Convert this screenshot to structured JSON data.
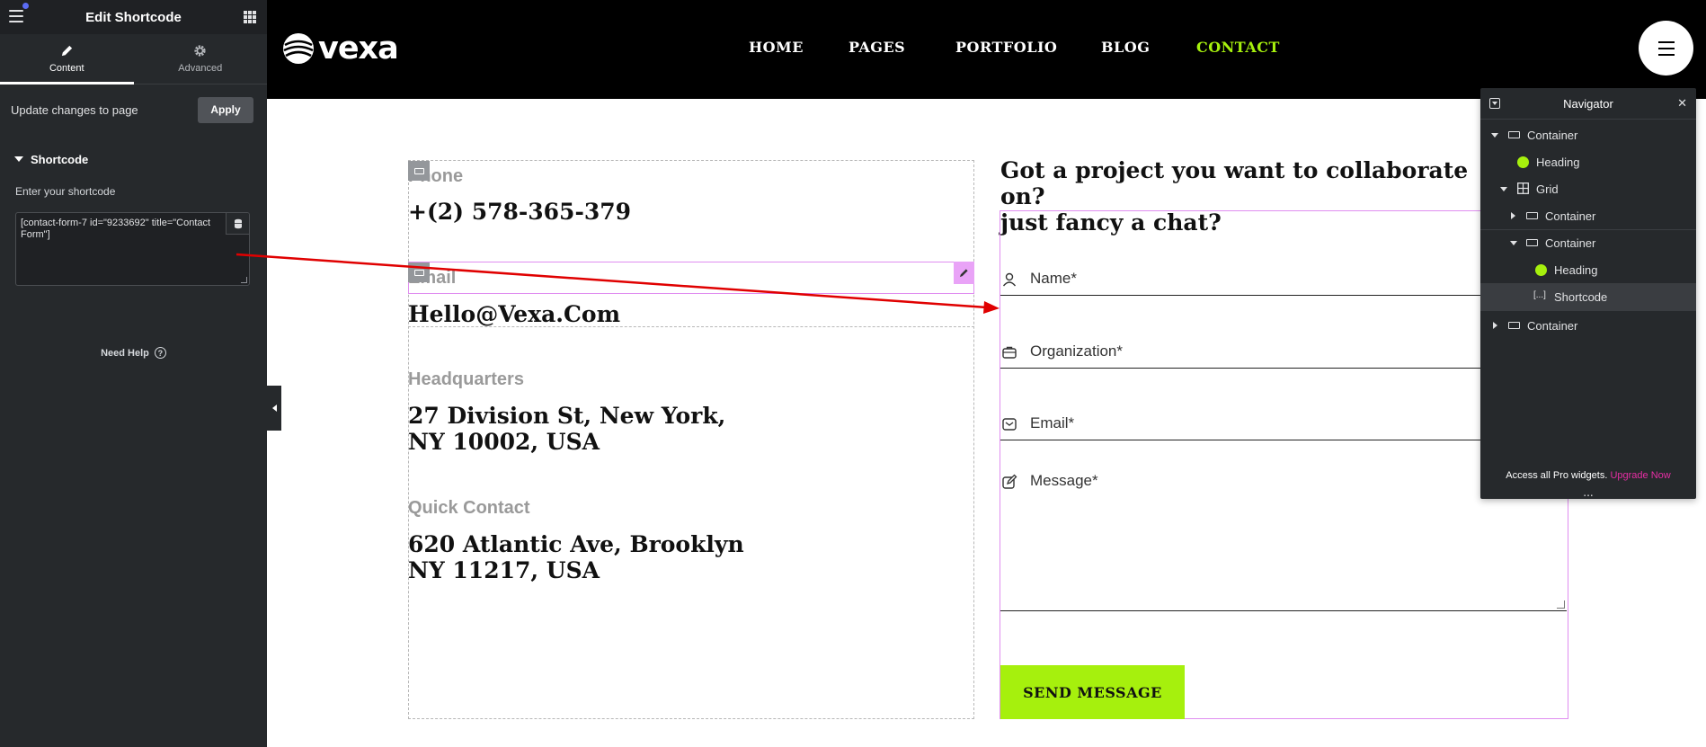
{
  "editor": {
    "title": "Edit Shortcode",
    "tabs": [
      {
        "label": "Content",
        "icon": "pencil-icon",
        "active": true
      },
      {
        "label": "Advanced",
        "icon": "gear-icon",
        "active": false
      }
    ],
    "update_label": "Update changes to page",
    "apply_label": "Apply",
    "section_title": "Shortcode",
    "shortcode_label": "Enter your shortcode",
    "shortcode_value": "[contact-form-7 id=\"9233692\" title=\"Contact Form\"]",
    "help_label": "Need Help"
  },
  "site": {
    "logo_text": "vexa",
    "nav": [
      {
        "label": "HOME",
        "active": false
      },
      {
        "label": "PAGES",
        "active": false
      },
      {
        "label": "PORTFOLIO",
        "active": false
      },
      {
        "label": "BLOG",
        "active": false
      },
      {
        "label": "CONTACT",
        "active": true
      }
    ],
    "accent_color": "#a6f00d"
  },
  "contact_info": {
    "phone_label": "Phone",
    "phone_value": "+(2) 578-365-379",
    "email_label": "Email",
    "email_value": "Hello@Vexa.Com",
    "hq_label": "Headquarters",
    "hq_value_line1": "27 Division St, New York,",
    "hq_value_line2": "NY 10002, USA",
    "quick_label": "Quick Contact",
    "quick_value_line1": "620 Atlantic Ave, Brooklyn",
    "quick_value_line2": "NY 11217, USA"
  },
  "form": {
    "heading_line1": "Got a project you want to collaborate on?",
    "heading_line2": "just fancy a chat?",
    "fields": [
      {
        "label": "Name*",
        "icon": "user-icon"
      },
      {
        "label": "Organization*",
        "icon": "briefcase-icon"
      },
      {
        "label": "Email*",
        "icon": "mail-icon"
      }
    ],
    "message_label": "Message*",
    "message_icon": "pen-icon",
    "submit_label": "SEND MESSAGE"
  },
  "navigator": {
    "title": "Navigator",
    "items": [
      {
        "label": "Container",
        "type": "container",
        "expanded": true
      },
      {
        "label": "Heading",
        "type": "heading"
      },
      {
        "label": "Grid",
        "type": "grid",
        "expanded": true
      },
      {
        "label": "Container",
        "type": "container",
        "expanded": false
      },
      {
        "label": "Container",
        "type": "container",
        "expanded": true
      },
      {
        "label": "Heading",
        "type": "heading"
      },
      {
        "label": "Shortcode",
        "type": "shortcode",
        "selected": true
      },
      {
        "label": "Container",
        "type": "container",
        "expanded": false
      }
    ],
    "footer_text": "Access all Pro widgets.",
    "upgrade_label": "Upgrade Now",
    "more_label": "..."
  }
}
